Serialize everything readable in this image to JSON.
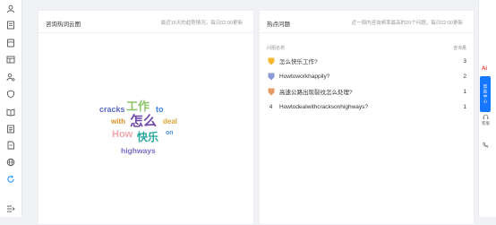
{
  "sidebar": {
    "icons": [
      "person-icon",
      "book-icon",
      "document-icon",
      "calendar-icon",
      "user-settings-icon",
      "shield-icon",
      "book-open-icon",
      "list-icon",
      "file-icon",
      "globe-icon",
      "refresh-icon",
      "expand-icon"
    ]
  },
  "wordcloud_card": {
    "title": "咨询热词云图",
    "subtitle": "最近15天的趋势情况，每日02:00更新",
    "words": [
      {
        "text": "cracks",
        "color": "#5b6bc0"
      },
      {
        "text": "工作",
        "color": "#8fc46b"
      },
      {
        "text": "to",
        "color": "#3b7dd8"
      },
      {
        "text": "with",
        "color": "#d9912b"
      },
      {
        "text": "怎么",
        "color": "#6e4aa8"
      },
      {
        "text": "deal",
        "color": "#d9a43a"
      },
      {
        "text": "How",
        "color": "#f2a7b0"
      },
      {
        "text": "快乐",
        "color": "#2aa6a0"
      },
      {
        "text": "on",
        "color": "#4a8fd6"
      },
      {
        "text": "highways",
        "color": "#7a6cc4"
      }
    ]
  },
  "hot_card": {
    "title": "热点问题",
    "subtitle": "近一周内咨询频率最高的20个问题，每日02:00更新",
    "col_question": "问题名称",
    "col_count": "咨询量",
    "rows": [
      {
        "rank": "1",
        "question": "怎么快乐工作?",
        "count": "3",
        "medal": "#f5b82e"
      },
      {
        "rank": "2",
        "question": "Howtoworkhappily?",
        "count": "2",
        "medal": "#8c9bd6"
      },
      {
        "rank": "3",
        "question": "高速公路出现裂纹怎么处理?",
        "count": "1",
        "medal": "#e59b63"
      },
      {
        "rank": "4",
        "question": "Howtodealwithcracksonhighways?",
        "count": "1",
        "medal": ""
      }
    ]
  },
  "right_rail": {
    "ai_label": "Ai",
    "service_label": "帮助中心",
    "support_label": "客服",
    "colors": {
      "accent": "#1677ff",
      "ai": "#e8382f"
    }
  }
}
